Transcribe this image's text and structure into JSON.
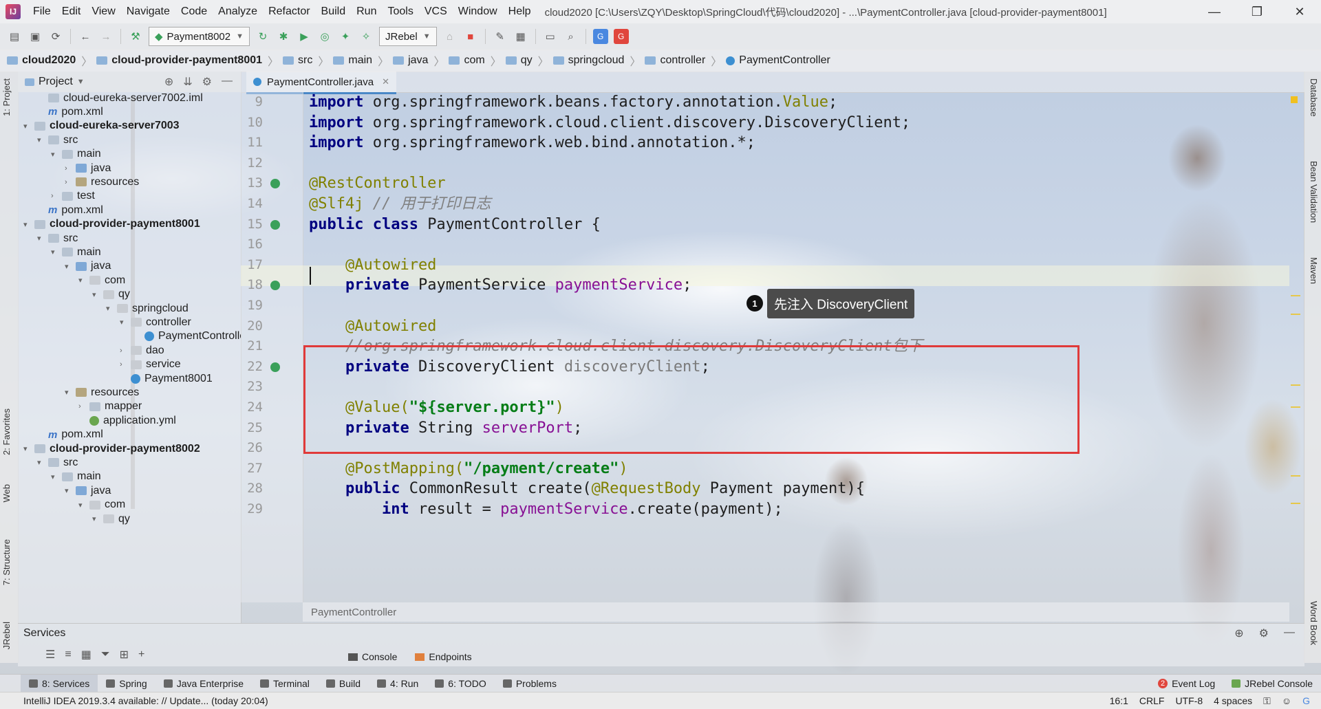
{
  "window": {
    "title": "cloud2020 [C:\\Users\\ZQY\\Desktop\\SpringCloud\\代码\\cloud2020] - ...\\PaymentController.java [cloud-provider-payment8001]"
  },
  "menu": [
    "File",
    "Edit",
    "View",
    "Navigate",
    "Code",
    "Analyze",
    "Refactor",
    "Build",
    "Run",
    "Tools",
    "VCS",
    "Window",
    "Help"
  ],
  "toolbar": {
    "run_config": "Payment8002",
    "jrebel_combo": "JRebel"
  },
  "breadcrumb": [
    "cloud2020",
    "cloud-provider-payment8001",
    "src",
    "main",
    "java",
    "com",
    "qy",
    "springcloud",
    "controller",
    "PaymentController"
  ],
  "project_panel": {
    "title": "Project",
    "items": [
      {
        "label": "cloud-eureka-server7002.iml",
        "indent": 1,
        "icon": "iml",
        "arrow": ""
      },
      {
        "label": "pom.xml",
        "indent": 1,
        "icon": "xml",
        "arrow": ""
      },
      {
        "label": "cloud-eureka-server7003",
        "indent": 0,
        "icon": "folder",
        "arrow": "▾",
        "bold": true
      },
      {
        "label": "src",
        "indent": 1,
        "icon": "folder",
        "arrow": "▾"
      },
      {
        "label": "main",
        "indent": 2,
        "icon": "folder",
        "arrow": "▾"
      },
      {
        "label": "java",
        "indent": 3,
        "icon": "src",
        "arrow": "›"
      },
      {
        "label": "resources",
        "indent": 3,
        "icon": "res",
        "arrow": "›"
      },
      {
        "label": "test",
        "indent": 2,
        "icon": "folder",
        "arrow": "›"
      },
      {
        "label": "pom.xml",
        "indent": 1,
        "icon": "xml",
        "arrow": ""
      },
      {
        "label": "cloud-provider-payment8001",
        "indent": 0,
        "icon": "folder",
        "arrow": "▾",
        "bold": true
      },
      {
        "label": "src",
        "indent": 1,
        "icon": "folder",
        "arrow": "▾"
      },
      {
        "label": "main",
        "indent": 2,
        "icon": "folder",
        "arrow": "▾"
      },
      {
        "label": "java",
        "indent": 3,
        "icon": "src",
        "arrow": "▾"
      },
      {
        "label": "com",
        "indent": 4,
        "icon": "pkg",
        "arrow": "▾"
      },
      {
        "label": "qy",
        "indent": 5,
        "icon": "pkg",
        "arrow": "▾"
      },
      {
        "label": "springcloud",
        "indent": 6,
        "icon": "pkg",
        "arrow": "▾"
      },
      {
        "label": "controller",
        "indent": 7,
        "icon": "pkg",
        "arrow": "▾"
      },
      {
        "label": "PaymentController",
        "indent": 8,
        "icon": "cls",
        "arrow": ""
      },
      {
        "label": "dao",
        "indent": 7,
        "icon": "pkg",
        "arrow": "›"
      },
      {
        "label": "service",
        "indent": 7,
        "icon": "pkg",
        "arrow": "›"
      },
      {
        "label": "Payment8001",
        "indent": 7,
        "icon": "cls",
        "arrow": ""
      },
      {
        "label": "resources",
        "indent": 3,
        "icon": "res",
        "arrow": "▾"
      },
      {
        "label": "mapper",
        "indent": 4,
        "icon": "folder",
        "arrow": "›"
      },
      {
        "label": "application.yml",
        "indent": 4,
        "icon": "yml",
        "arrow": ""
      },
      {
        "label": "pom.xml",
        "indent": 1,
        "icon": "xml",
        "arrow": ""
      },
      {
        "label": "cloud-provider-payment8002",
        "indent": 0,
        "icon": "folder",
        "arrow": "▾",
        "bold": true
      },
      {
        "label": "src",
        "indent": 1,
        "icon": "folder",
        "arrow": "▾"
      },
      {
        "label": "main",
        "indent": 2,
        "icon": "folder",
        "arrow": "▾"
      },
      {
        "label": "java",
        "indent": 3,
        "icon": "src",
        "arrow": "▾"
      },
      {
        "label": "com",
        "indent": 4,
        "icon": "pkg",
        "arrow": "▾"
      },
      {
        "label": "qy",
        "indent": 5,
        "icon": "pkg",
        "arrow": "▾"
      }
    ]
  },
  "editor": {
    "tab": "PaymentController.java",
    "lines": [
      {
        "no": "9",
        "segs": [
          {
            "t": "import ",
            "c": "kw"
          },
          {
            "t": "org.springframework.beans.factory.annotation.",
            "c": ""
          },
          {
            "t": "Value",
            "c": "ann"
          },
          {
            "t": ";",
            "c": ""
          }
        ]
      },
      {
        "no": "10",
        "segs": [
          {
            "t": "import ",
            "c": "kw"
          },
          {
            "t": "org.springframework.cloud.client.discovery.DiscoveryClient;",
            "c": ""
          }
        ]
      },
      {
        "no": "11",
        "segs": [
          {
            "t": "import ",
            "c": "kw"
          },
          {
            "t": "org.springframework.web.bind.annotation.*;",
            "c": ""
          }
        ]
      },
      {
        "no": "12",
        "segs": []
      },
      {
        "no": "13",
        "segs": [
          {
            "t": "@RestController",
            "c": "ann"
          }
        ],
        "gutter": true
      },
      {
        "no": "14",
        "segs": [
          {
            "t": "@Slf4j ",
            "c": "ann"
          },
          {
            "t": "// 用于打印日志",
            "c": "cm"
          }
        ]
      },
      {
        "no": "15",
        "segs": [
          {
            "t": "public class ",
            "c": "kw"
          },
          {
            "t": "PaymentController {",
            "c": ""
          }
        ],
        "gutter": true
      },
      {
        "no": "16",
        "segs": []
      },
      {
        "no": "17",
        "segs": [
          {
            "t": "    @Autowired",
            "c": "ann"
          }
        ]
      },
      {
        "no": "18",
        "segs": [
          {
            "t": "    private ",
            "c": "kw"
          },
          {
            "t": "PaymentService ",
            "c": ""
          },
          {
            "t": "paymentService",
            "c": "fld"
          },
          {
            "t": ";",
            "c": ""
          }
        ],
        "gutter": true
      },
      {
        "no": "19",
        "segs": []
      },
      {
        "no": "20",
        "segs": [
          {
            "t": "    @Autowired",
            "c": "ann"
          }
        ]
      },
      {
        "no": "21",
        "segs": [
          {
            "t": "    //org.springframework.cloud.client.discovery.DiscoveryClient包下",
            "c": "cm"
          }
        ]
      },
      {
        "no": "22",
        "segs": [
          {
            "t": "    private ",
            "c": "kw"
          },
          {
            "t": "DiscoveryClient ",
            "c": ""
          },
          {
            "t": "discoveryClient",
            "c": "fld-g"
          },
          {
            "t": ";",
            "c": ""
          }
        ],
        "gutter": true
      },
      {
        "no": "23",
        "segs": []
      },
      {
        "no": "24",
        "segs": [
          {
            "t": "    @Value(",
            "c": "ann"
          },
          {
            "t": "\"${server.port}\"",
            "c": "str"
          },
          {
            "t": ")",
            "c": "ann"
          }
        ]
      },
      {
        "no": "25",
        "segs": [
          {
            "t": "    private ",
            "c": "kw"
          },
          {
            "t": "String ",
            "c": ""
          },
          {
            "t": "serverPort",
            "c": "fld"
          },
          {
            "t": ";",
            "c": ""
          }
        ]
      },
      {
        "no": "26",
        "segs": []
      },
      {
        "no": "27",
        "segs": [
          {
            "t": "    @PostMapping(",
            "c": "ann"
          },
          {
            "t": "\"/payment/create\"",
            "c": "str"
          },
          {
            "t": ")",
            "c": "ann"
          }
        ]
      },
      {
        "no": "28",
        "segs": [
          {
            "t": "    public ",
            "c": "kw"
          },
          {
            "t": "CommonResult create(",
            "c": ""
          },
          {
            "t": "@RequestBody ",
            "c": "ann"
          },
          {
            "t": "Payment payment){",
            "c": ""
          }
        ]
      },
      {
        "no": "29",
        "segs": [
          {
            "t": "        int ",
            "c": "kw"
          },
          {
            "t": "result = ",
            "c": ""
          },
          {
            "t": "paymentService",
            "c": "fld"
          },
          {
            "t": ".create(payment);",
            "c": ""
          }
        ]
      }
    ],
    "bottom_breadcrumb": "PaymentController",
    "tooltip_number": "1",
    "tooltip_text": "先注入 DiscoveryClient"
  },
  "services": {
    "title": "Services",
    "tabs": [
      "Console",
      "Endpoints"
    ]
  },
  "left_vertical_tabs": [
    "1: Project",
    "2: Favorites",
    "Web",
    "7: Structure",
    "JRebel"
  ],
  "right_vertical_tabs": [
    "Database",
    "Bean Validation",
    "Maven",
    "Word Book"
  ],
  "bottom_tabs": [
    {
      "label": "8: Services",
      "active": true
    },
    {
      "label": "Spring"
    },
    {
      "label": "Java Enterprise"
    },
    {
      "label": "Terminal"
    },
    {
      "label": "Build"
    },
    {
      "label": "4: Run"
    },
    {
      "label": "6: TODO"
    },
    {
      "label": "Problems"
    }
  ],
  "bottom_right_tabs": {
    "event_log_count": "2",
    "event_log": "Event Log",
    "jrebel_console": "JRebel Console"
  },
  "status": {
    "message": "IntelliJ IDEA 2019.3.4 available: // Update... (today 20:04)",
    "position": "16:1",
    "line_sep": "CRLF",
    "encoding": "UTF-8",
    "indent": "4 spaces"
  },
  "colors": {
    "keyword": "#000080",
    "annotation": "#808000",
    "string": "#067d17",
    "field": "#871094",
    "highlight_box": "#e03a3a"
  }
}
